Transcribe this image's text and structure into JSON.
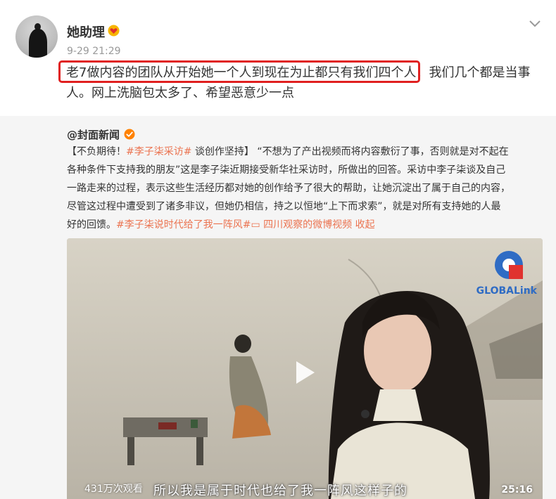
{
  "post": {
    "username": "她助理",
    "badge_icon": "heart-badge-icon",
    "timestamp": "9-29 21:29",
    "text_lines": [
      "老7做内容的团队从开始她一个人到现在为止都只有我们四个人！我们几个都是当事",
      "人。网上洗脑包太多了、希望恶意少一点"
    ],
    "more_icon": "chevron-down-icon"
  },
  "repost": {
    "author": "@封面新闻",
    "verified_icon": "verified-icon",
    "lines": [
      {
        "parts": [
          {
            "text": "【不负期待！",
            "kind": "plain"
          },
          {
            "text": "#李子柒采访#",
            "kind": "tag"
          },
          {
            "text": " 谈创作坚持】 “不想为了产出视频而将内容敷衍了事，否则就是对不起在",
            "kind": "plain"
          }
        ]
      },
      {
        "parts": [
          {
            "text": "各种条件下支持我的朋友”这是李子柒近期接受新华社采访时，所做出的回答。采访中李子柒谈及自己",
            "kind": "plain"
          }
        ]
      },
      {
        "parts": [
          {
            "text": "一路走来的过程，表示这些生活经历都对她的创作给予了很大的帮助，让她沉淀出了属于自己的内容，",
            "kind": "plain"
          }
        ]
      },
      {
        "parts": [
          {
            "text": "尽管这过程中遭受到了诸多非议，但她仍相信，持之以恒地“上下而求索”，就是对所有支持她的人最",
            "kind": "plain"
          }
        ]
      },
      {
        "parts": [
          {
            "text": "好的回馈。",
            "kind": "plain"
          },
          {
            "text": "#李子柒说时代给了我一阵风#",
            "kind": "tag"
          },
          {
            "text": "▭",
            "kind": "video-glyph"
          },
          {
            "text": " 四川观察的微博视频",
            "kind": "link"
          },
          {
            "text": " 收起",
            "kind": "link"
          }
        ]
      }
    ]
  },
  "video": {
    "views": "431万次观看",
    "duration": "25:16",
    "subtitle": "所以我是属于时代也给了我一阵风这样子的",
    "logo_text": "GLOBALink",
    "play_icon": "play-icon"
  },
  "colors": {
    "tag": "#eb7350",
    "highlight_border": "#e02020",
    "repost_bg": "#f5f5f5",
    "verified": "#ff8200",
    "logo": "#2f6cc4"
  }
}
